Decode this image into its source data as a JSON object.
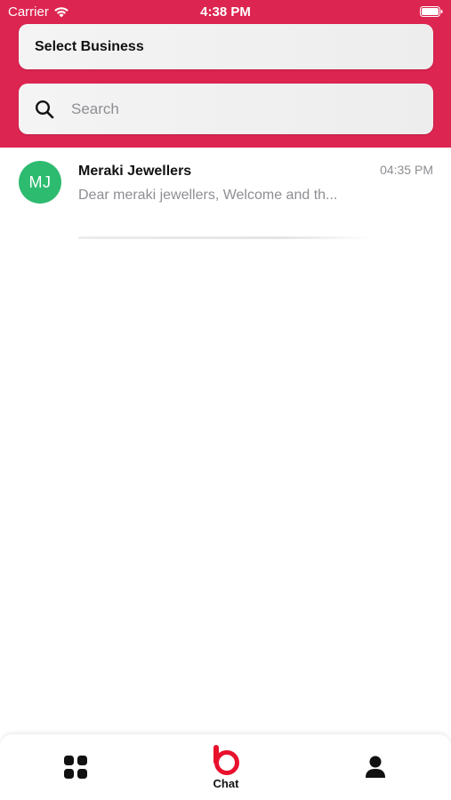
{
  "status_bar": {
    "carrier": "Carrier",
    "time": "4:38 PM",
    "icons": [
      "wifi-icon",
      "battery-icon"
    ]
  },
  "header": {
    "background_color": "#dc2550",
    "select_business": {
      "label": "Select Business"
    },
    "search": {
      "placeholder": "Search",
      "value": "",
      "icon": "search-icon"
    }
  },
  "chats": [
    {
      "initials": "MJ",
      "avatar_color": "#2dbb70",
      "name": "Meraki Jewellers",
      "preview": "Dear meraki jewellers, Welcome and th...",
      "time": "04:35 PM"
    }
  ],
  "tab_bar": {
    "tabs": [
      {
        "icon": "grid-icon",
        "label": ""
      },
      {
        "icon": "chat-logo-icon",
        "label": "Chat",
        "active": true
      },
      {
        "icon": "profile-icon",
        "label": ""
      }
    ],
    "accent_color": "#e8112d"
  }
}
